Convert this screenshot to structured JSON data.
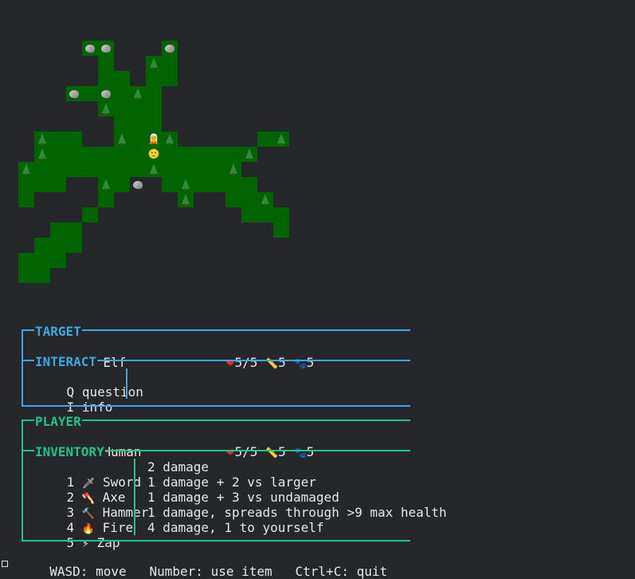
{
  "map": {
    "ground_color": "#006400",
    "player_icon": "slightly-smiling-face",
    "target_icon": "elf"
  },
  "target": {
    "header": "TARGET",
    "icon": "🧝",
    "name": "Elf",
    "health": "5/5",
    "reach": "5",
    "speed": "5"
  },
  "interact": {
    "header": "INTERACT",
    "items": [
      {
        "key": "Q",
        "label": "question"
      },
      {
        "key": "I",
        "label": "info"
      }
    ]
  },
  "player": {
    "header": "PLAYER",
    "icon": "🙂",
    "name": "Human",
    "health": "5/5",
    "reach": "5",
    "speed": "5"
  },
  "inventory": {
    "header": "INVENTORY",
    "items": [
      {
        "num": "1",
        "icon": "🗡",
        "name": "Sword",
        "desc": "2 damage"
      },
      {
        "num": "2",
        "icon": "🪓",
        "name": "Axe",
        "desc": "1 damage + 2 vs larger"
      },
      {
        "num": "3",
        "icon": "🔨",
        "name": "Hammer",
        "desc": "1 damage + 3 vs undamaged"
      },
      {
        "num": "4",
        "icon": "🔥",
        "name": "Fire",
        "desc": "1 damage, spreads through >9 max health"
      },
      {
        "num": "5",
        "icon": "⚡",
        "name": "Zap",
        "desc": "4 damage, 1 to yourself"
      }
    ]
  },
  "controls": {
    "move": "WASD: move",
    "use": "Number: use item",
    "quit": "Ctrl+C: quit"
  },
  "colors": {
    "background": "#25272b",
    "target_frame": "#3ea6e0",
    "player_frame": "#1fc486"
  },
  "stat_icons": {
    "health": "heart-icon",
    "reach": "ruler-icon",
    "speed": "paw-icon"
  }
}
